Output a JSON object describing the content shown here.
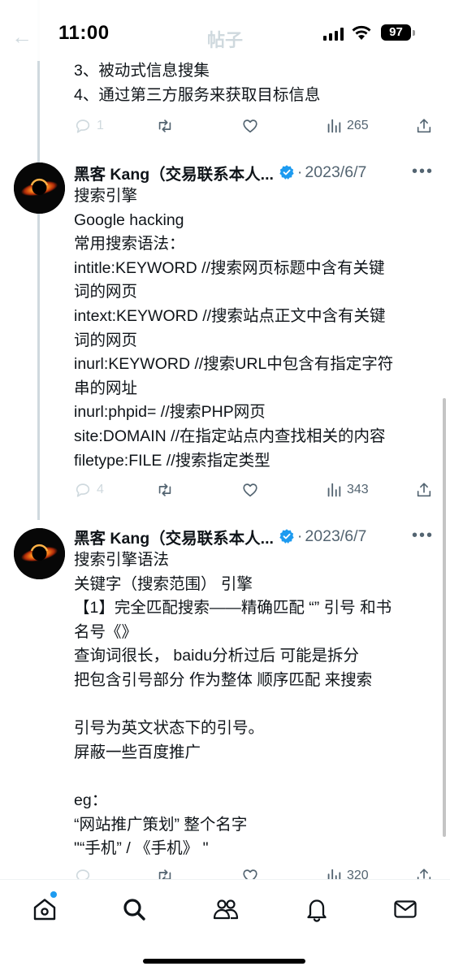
{
  "status_bar": {
    "time": "11:00",
    "battery": "97"
  },
  "header": {
    "title": "帖子"
  },
  "tweets": [
    {
      "text": "3、被动式信息搜集\n4、通过第三方服务来获取目标信息",
      "replies": "1",
      "views": "265"
    },
    {
      "author": "黑客 Kang（交易联系本人...",
      "separator": "·",
      "date": "2023/6/7",
      "text": "搜索引擎\nGoogle hacking\n常用搜索语法：\nintitle:KEYWORD //搜索网页标题中含有关键\n词的网页\nintext:KEYWORD //搜索站点正文中含有关键\n词的网页\ninurl:KEYWORD //搜索URL中包含有指定字符\n串的网址\ninurl:phpid= //搜索PHP网页\nsite:DOMAIN //在指定站点内查找相关的内容\nfiletype:FILE //搜索指定类型",
      "replies": "4",
      "views": "343"
    },
    {
      "author": "黑客 Kang（交易联系本人...",
      "separator": "·",
      "date": "2023/6/7",
      "text": "搜索引擎语法\n关键字（搜索范围） 引擎\n【1】完全匹配搜索——精确匹配 “” 引号 和书\n名号《》\n查询词很长， baidu分析过后 可能是拆分\n把包含引号部分 作为整体 顺序匹配 来搜索\n\n引号为英文状态下的引号。\n屏蔽一些百度推广\n\neg：\n“网站推广策划” 整个名字\n\"“手机” / 《手机》 \"",
      "replies": "",
      "views": "320"
    }
  ],
  "icons": {
    "reply": "reply-icon",
    "retweet": "retweet-icon",
    "like": "heart-icon",
    "views": "views-icon",
    "share": "share-icon",
    "verified": "verified-badge-icon",
    "more": "more-icon"
  },
  "bottom_nav": [
    "home-icon",
    "search-icon",
    "communities-icon",
    "notifications-icon",
    "messages-icon"
  ],
  "colors": {
    "accent": "#1d9bf0",
    "muted": "#536471",
    "text": "#0f1419"
  }
}
